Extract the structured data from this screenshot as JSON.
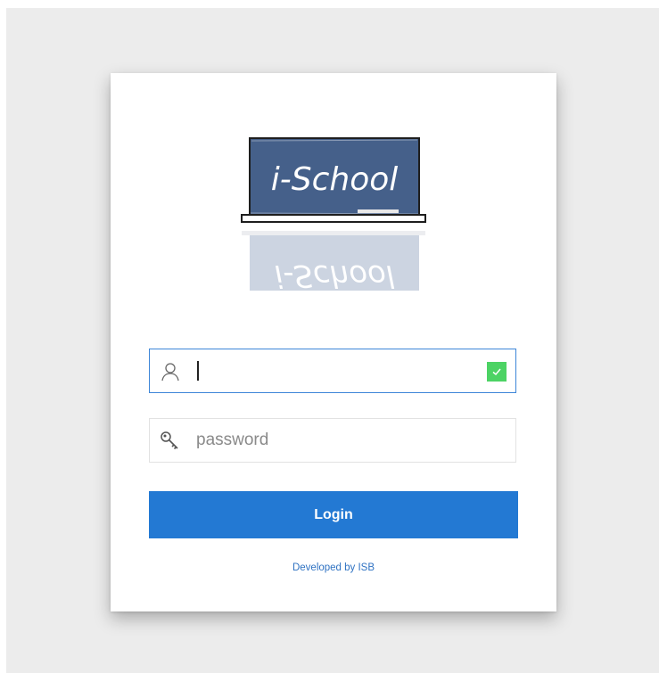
{
  "logo": {
    "text": "i-School",
    "board_color": "#45608a",
    "reflection_color": "#d8dde6"
  },
  "username": {
    "value": "",
    "placeholder": "",
    "validated": true
  },
  "password": {
    "value": "",
    "placeholder": "password"
  },
  "login_button": {
    "label": "Login",
    "color": "#2379d3"
  },
  "footer": {
    "link_text": "Developed by ISB",
    "color": "#2f72c2"
  },
  "icons": {
    "username": "user-icon",
    "password": "key-icon",
    "valid": "check-icon"
  }
}
